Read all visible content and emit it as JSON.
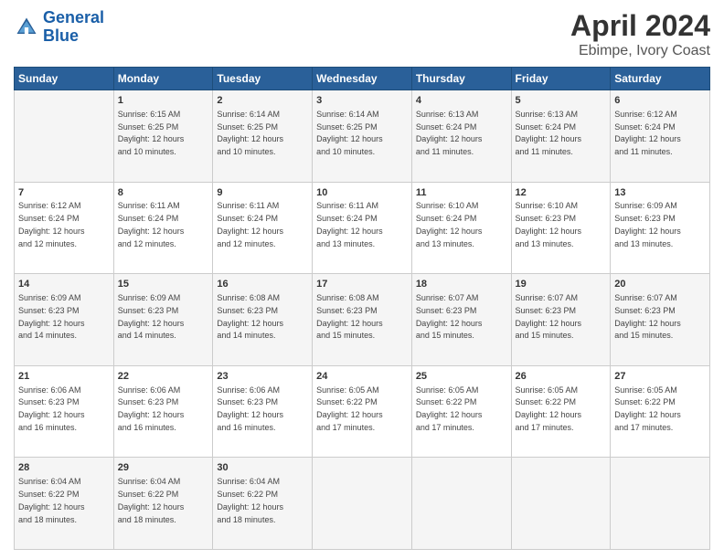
{
  "header": {
    "logo_line1": "General",
    "logo_line2": "Blue",
    "title": "April 2024",
    "subtitle": "Ebimpe, Ivory Coast"
  },
  "days_of_week": [
    "Sunday",
    "Monday",
    "Tuesday",
    "Wednesday",
    "Thursday",
    "Friday",
    "Saturday"
  ],
  "weeks": [
    [
      {
        "day": "",
        "info": ""
      },
      {
        "day": "1",
        "info": "Sunrise: 6:15 AM\nSunset: 6:25 PM\nDaylight: 12 hours\nand 10 minutes."
      },
      {
        "day": "2",
        "info": "Sunrise: 6:14 AM\nSunset: 6:25 PM\nDaylight: 12 hours\nand 10 minutes."
      },
      {
        "day": "3",
        "info": "Sunrise: 6:14 AM\nSunset: 6:25 PM\nDaylight: 12 hours\nand 10 minutes."
      },
      {
        "day": "4",
        "info": "Sunrise: 6:13 AM\nSunset: 6:24 PM\nDaylight: 12 hours\nand 11 minutes."
      },
      {
        "day": "5",
        "info": "Sunrise: 6:13 AM\nSunset: 6:24 PM\nDaylight: 12 hours\nand 11 minutes."
      },
      {
        "day": "6",
        "info": "Sunrise: 6:12 AM\nSunset: 6:24 PM\nDaylight: 12 hours\nand 11 minutes."
      }
    ],
    [
      {
        "day": "7",
        "info": "Sunrise: 6:12 AM\nSunset: 6:24 PM\nDaylight: 12 hours\nand 12 minutes."
      },
      {
        "day": "8",
        "info": "Sunrise: 6:11 AM\nSunset: 6:24 PM\nDaylight: 12 hours\nand 12 minutes."
      },
      {
        "day": "9",
        "info": "Sunrise: 6:11 AM\nSunset: 6:24 PM\nDaylight: 12 hours\nand 12 minutes."
      },
      {
        "day": "10",
        "info": "Sunrise: 6:11 AM\nSunset: 6:24 PM\nDaylight: 12 hours\nand 13 minutes."
      },
      {
        "day": "11",
        "info": "Sunrise: 6:10 AM\nSunset: 6:24 PM\nDaylight: 12 hours\nand 13 minutes."
      },
      {
        "day": "12",
        "info": "Sunrise: 6:10 AM\nSunset: 6:23 PM\nDaylight: 12 hours\nand 13 minutes."
      },
      {
        "day": "13",
        "info": "Sunrise: 6:09 AM\nSunset: 6:23 PM\nDaylight: 12 hours\nand 13 minutes."
      }
    ],
    [
      {
        "day": "14",
        "info": "Sunrise: 6:09 AM\nSunset: 6:23 PM\nDaylight: 12 hours\nand 14 minutes."
      },
      {
        "day": "15",
        "info": "Sunrise: 6:09 AM\nSunset: 6:23 PM\nDaylight: 12 hours\nand 14 minutes."
      },
      {
        "day": "16",
        "info": "Sunrise: 6:08 AM\nSunset: 6:23 PM\nDaylight: 12 hours\nand 14 minutes."
      },
      {
        "day": "17",
        "info": "Sunrise: 6:08 AM\nSunset: 6:23 PM\nDaylight: 12 hours\nand 15 minutes."
      },
      {
        "day": "18",
        "info": "Sunrise: 6:07 AM\nSunset: 6:23 PM\nDaylight: 12 hours\nand 15 minutes."
      },
      {
        "day": "19",
        "info": "Sunrise: 6:07 AM\nSunset: 6:23 PM\nDaylight: 12 hours\nand 15 minutes."
      },
      {
        "day": "20",
        "info": "Sunrise: 6:07 AM\nSunset: 6:23 PM\nDaylight: 12 hours\nand 15 minutes."
      }
    ],
    [
      {
        "day": "21",
        "info": "Sunrise: 6:06 AM\nSunset: 6:23 PM\nDaylight: 12 hours\nand 16 minutes."
      },
      {
        "day": "22",
        "info": "Sunrise: 6:06 AM\nSunset: 6:23 PM\nDaylight: 12 hours\nand 16 minutes."
      },
      {
        "day": "23",
        "info": "Sunrise: 6:06 AM\nSunset: 6:23 PM\nDaylight: 12 hours\nand 16 minutes."
      },
      {
        "day": "24",
        "info": "Sunrise: 6:05 AM\nSunset: 6:22 PM\nDaylight: 12 hours\nand 17 minutes."
      },
      {
        "day": "25",
        "info": "Sunrise: 6:05 AM\nSunset: 6:22 PM\nDaylight: 12 hours\nand 17 minutes."
      },
      {
        "day": "26",
        "info": "Sunrise: 6:05 AM\nSunset: 6:22 PM\nDaylight: 12 hours\nand 17 minutes."
      },
      {
        "day": "27",
        "info": "Sunrise: 6:05 AM\nSunset: 6:22 PM\nDaylight: 12 hours\nand 17 minutes."
      }
    ],
    [
      {
        "day": "28",
        "info": "Sunrise: 6:04 AM\nSunset: 6:22 PM\nDaylight: 12 hours\nand 18 minutes."
      },
      {
        "day": "29",
        "info": "Sunrise: 6:04 AM\nSunset: 6:22 PM\nDaylight: 12 hours\nand 18 minutes."
      },
      {
        "day": "30",
        "info": "Sunrise: 6:04 AM\nSunset: 6:22 PM\nDaylight: 12 hours\nand 18 minutes."
      },
      {
        "day": "",
        "info": ""
      },
      {
        "day": "",
        "info": ""
      },
      {
        "day": "",
        "info": ""
      },
      {
        "day": "",
        "info": ""
      }
    ]
  ]
}
